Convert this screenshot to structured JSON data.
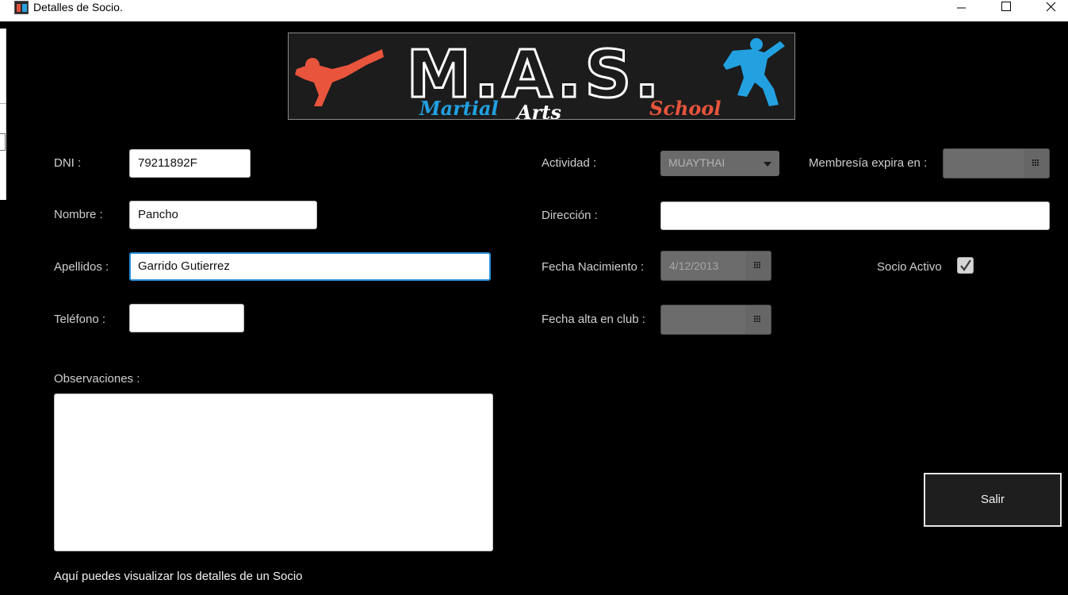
{
  "window": {
    "title": "Detalles de Socio."
  },
  "logo": {
    "title": "M.A.S.",
    "subtitle_words": [
      "Martial",
      "Arts",
      "School"
    ],
    "colors": {
      "left_fighter": "#e8543c",
      "right_fighter": "#22a0e0",
      "martial": "#22a0e0",
      "arts": "#ffffff",
      "school": "#e8543c"
    }
  },
  "form": {
    "dni": {
      "label": "DNI :",
      "value": "79211892F"
    },
    "nombre": {
      "label": "Nombre :",
      "value": "Pancho"
    },
    "apellidos": {
      "label": "Apellidos :",
      "value": "Garrido Gutierrez"
    },
    "telefono": {
      "label": "Teléfono :",
      "value": ""
    },
    "observaciones": {
      "label": "Observaciones :",
      "value": ""
    },
    "actividad": {
      "label": "Actividad :",
      "value": "MUAYTHAI"
    },
    "membresia": {
      "label": "Membresía expira en :",
      "value": ""
    },
    "direccion": {
      "label": "Dirección :",
      "value": ""
    },
    "fecha_nacimiento": {
      "label": "Fecha Nacimiento :",
      "value": "4/12/2013"
    },
    "socio_activo": {
      "label": "Socio Activo",
      "checked": true
    },
    "fecha_alta": {
      "label": "Fecha alta en club :",
      "value": ""
    }
  },
  "buttons": {
    "salir": "Salir"
  },
  "footer": {
    "text": "Aquí puedes visualizar los detalles de un Socio"
  },
  "icons": [
    "app-icon",
    "minimize-icon",
    "maximize-icon",
    "close-icon",
    "chevron-down-icon",
    "calendar-icon",
    "checkmark-icon"
  ]
}
